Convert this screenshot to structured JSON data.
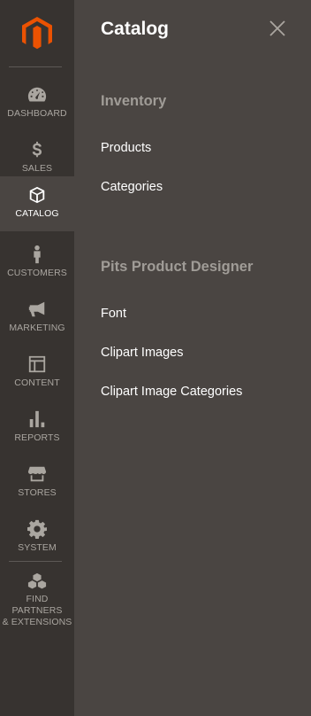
{
  "sidebar": {
    "items": [
      {
        "label": "DASHBOARD",
        "icon": "dashboard-icon"
      },
      {
        "label": "SALES",
        "icon": "dollar-icon"
      },
      {
        "label": "CATALOG",
        "icon": "box-icon"
      },
      {
        "label": "CUSTOMERS",
        "icon": "person-icon"
      },
      {
        "label": "MARKETING",
        "icon": "megaphone-icon"
      },
      {
        "label": "CONTENT",
        "icon": "layout-icon"
      },
      {
        "label": "REPORTS",
        "icon": "bar-chart-icon"
      },
      {
        "label": "STORES",
        "icon": "storefront-icon"
      },
      {
        "label": "SYSTEM",
        "icon": "gear-icon"
      },
      {
        "label_line1": "FIND PARTNERS",
        "label_line2": "& EXTENSIONS",
        "icon": "cubes-icon"
      }
    ],
    "active": "CATALOG"
  },
  "panel": {
    "title": "Catalog",
    "sections": [
      {
        "title": "Inventory",
        "links": [
          "Products",
          "Categories"
        ]
      },
      {
        "title": "Pits Product Designer",
        "links": [
          "Font",
          "Clipart Images",
          "Clipart Image Categories"
        ]
      }
    ]
  },
  "colors": {
    "sidebar_bg": "#373330",
    "panel_bg": "#4a4542",
    "brand": "#eb5202",
    "muted_text": "#aaa6a0"
  }
}
